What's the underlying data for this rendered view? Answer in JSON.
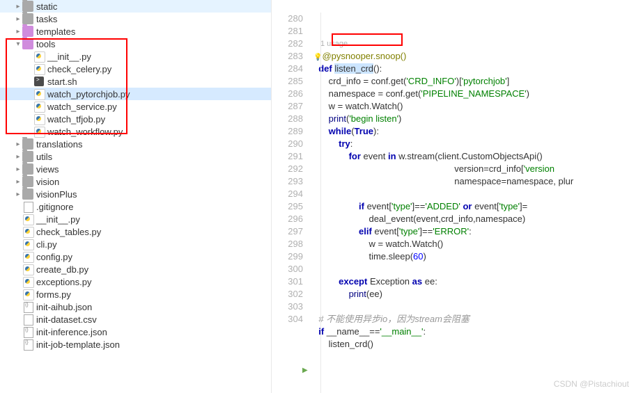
{
  "sidebar": {
    "items": [
      {
        "name": "static",
        "type": "folder",
        "indent": 1,
        "arrow": "▸"
      },
      {
        "name": "tasks",
        "type": "folder",
        "indent": 1,
        "arrow": "▸"
      },
      {
        "name": "templates",
        "type": "folder-open",
        "indent": 1,
        "arrow": "▸"
      },
      {
        "name": "tools",
        "type": "folder-open",
        "indent": 1,
        "arrow": "▾"
      },
      {
        "name": "__init__.py",
        "type": "py",
        "indent": 2,
        "arrow": ""
      },
      {
        "name": "check_celery.py",
        "type": "py",
        "indent": 2,
        "arrow": ""
      },
      {
        "name": "start.sh",
        "type": "sh",
        "indent": 2,
        "arrow": ""
      },
      {
        "name": "watch_pytorchjob.py",
        "type": "py",
        "indent": 2,
        "arrow": "",
        "selected": true
      },
      {
        "name": "watch_service.py",
        "type": "py",
        "indent": 2,
        "arrow": ""
      },
      {
        "name": "watch_tfjob.py",
        "type": "py",
        "indent": 2,
        "arrow": ""
      },
      {
        "name": "watch_workflow.py",
        "type": "py",
        "indent": 2,
        "arrow": ""
      },
      {
        "name": "translations",
        "type": "folder",
        "indent": 1,
        "arrow": "▸"
      },
      {
        "name": "utils",
        "type": "folder",
        "indent": 1,
        "arrow": "▸"
      },
      {
        "name": "views",
        "type": "folder",
        "indent": 1,
        "arrow": "▸"
      },
      {
        "name": "vision",
        "type": "folder",
        "indent": 1,
        "arrow": "▸"
      },
      {
        "name": "visionPlus",
        "type": "folder",
        "indent": 1,
        "arrow": "▸"
      },
      {
        "name": ".gitignore",
        "type": "txt",
        "indent": 1,
        "arrow": ""
      },
      {
        "name": "__init__.py",
        "type": "py",
        "indent": 1,
        "arrow": ""
      },
      {
        "name": "check_tables.py",
        "type": "py",
        "indent": 1,
        "arrow": ""
      },
      {
        "name": "cli.py",
        "type": "py",
        "indent": 1,
        "arrow": ""
      },
      {
        "name": "config.py",
        "type": "py",
        "indent": 1,
        "arrow": ""
      },
      {
        "name": "create_db.py",
        "type": "py",
        "indent": 1,
        "arrow": ""
      },
      {
        "name": "exceptions.py",
        "type": "py",
        "indent": 1,
        "arrow": ""
      },
      {
        "name": "forms.py",
        "type": "py",
        "indent": 1,
        "arrow": ""
      },
      {
        "name": "init-aihub.json",
        "type": "json",
        "indent": 1,
        "arrow": ""
      },
      {
        "name": "init-dataset.csv",
        "type": "csv",
        "indent": 1,
        "arrow": ""
      },
      {
        "name": "init-inference.json",
        "type": "json",
        "indent": 1,
        "arrow": ""
      },
      {
        "name": "init-job-template.json",
        "type": "json",
        "indent": 1,
        "arrow": ""
      }
    ]
  },
  "editor": {
    "usage_hint": "1 usage",
    "lines": [
      {
        "n": 280,
        "html": "<span class='dec'>@pysnooper.snoop()</span>",
        "bulb": true
      },
      {
        "n": 281,
        "html": "<span class='kw'>def</span> <span class='hl'><span class='fn'>listen_crd</span></span>():"
      },
      {
        "n": 282,
        "html": "    crd_info = conf.get(<span class='str'>'CRD_INFO'</span>)[<span class='str'>'pytorchjob'</span>]"
      },
      {
        "n": 283,
        "html": "    namespace = conf.get(<span class='str'>'PIPELINE_NAMESPACE'</span>)"
      },
      {
        "n": 284,
        "html": "    w = watch.Watch()"
      },
      {
        "n": 285,
        "html": "    <span class='bi'>print</span>(<span class='str'>'begin listen'</span>)"
      },
      {
        "n": 286,
        "html": "    <span class='kw'>while</span>(<span class='kw'>True</span>):"
      },
      {
        "n": 287,
        "html": "        <span class='kw'>try</span>:"
      },
      {
        "n": 288,
        "html": "            <span class='kw'>for</span> event <span class='kw'>in</span> w.stream(client.CustomObjectsApi()"
      },
      {
        "n": 289,
        "html": "                                                      version=crd_info[<span class='str'>'version</span>"
      },
      {
        "n": 290,
        "html": "                                                      namespace=namespace, plur"
      },
      {
        "n": 291,
        "html": ""
      },
      {
        "n": 292,
        "html": "                <span class='kw'>if</span> event[<span class='str'>'type'</span>]==<span class='str'>'ADDED'</span> <span class='kw'>or</span> event[<span class='str'>'type'</span>]="
      },
      {
        "n": 293,
        "html": "                    deal_event(event,crd_info,namespace)"
      },
      {
        "n": 294,
        "html": "                <span class='kw'>elif</span> event[<span class='str'>'type'</span>]==<span class='str'>'ERROR'</span>:"
      },
      {
        "n": 295,
        "html": "                    w = watch.Watch()"
      },
      {
        "n": 296,
        "html": "                    time.sleep(<span class='num'>60</span>)"
      },
      {
        "n": 297,
        "html": ""
      },
      {
        "n": 298,
        "html": "        <span class='kw'>except</span> Exception <span class='kw'>as</span> ee:"
      },
      {
        "n": 299,
        "html": "            <span class='bi'>print</span>(ee)"
      },
      {
        "n": 300,
        "html": ""
      },
      {
        "n": 301,
        "html": "<span class='cmt'># 不能使用异步io，因为stream会阻塞</span>"
      },
      {
        "n": 302,
        "html": "<span class='kw'>if</span> __name__==<span class='str'>'__main__'</span>:"
      },
      {
        "n": 303,
        "html": "    listen_crd()"
      },
      {
        "n": 304,
        "html": ""
      }
    ]
  },
  "watermark": "CSDN @Pistachiout"
}
